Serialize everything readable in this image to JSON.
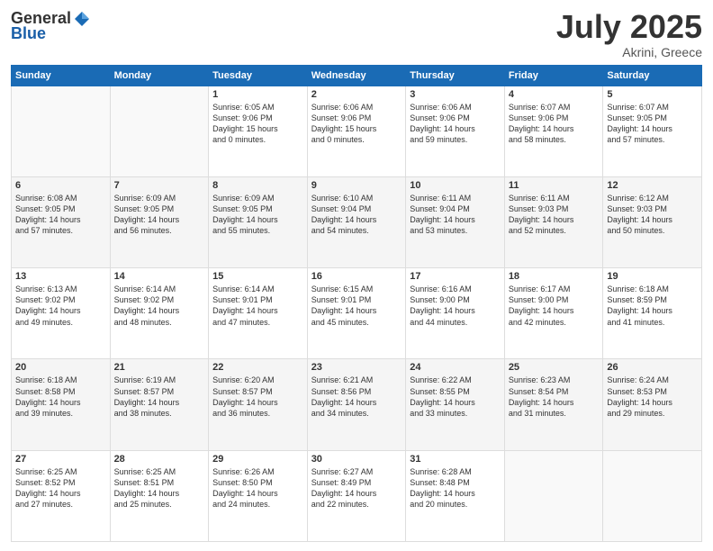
{
  "header": {
    "logo_general": "General",
    "logo_blue": "Blue",
    "month_year": "July 2025",
    "location": "Akrini, Greece"
  },
  "calendar": {
    "days_of_week": [
      "Sunday",
      "Monday",
      "Tuesday",
      "Wednesday",
      "Thursday",
      "Friday",
      "Saturday"
    ],
    "weeks": [
      [
        {
          "day": "",
          "content": ""
        },
        {
          "day": "",
          "content": ""
        },
        {
          "day": "1",
          "content": "Sunrise: 6:05 AM\nSunset: 9:06 PM\nDaylight: 15 hours\nand 0 minutes."
        },
        {
          "day": "2",
          "content": "Sunrise: 6:06 AM\nSunset: 9:06 PM\nDaylight: 15 hours\nand 0 minutes."
        },
        {
          "day": "3",
          "content": "Sunrise: 6:06 AM\nSunset: 9:06 PM\nDaylight: 14 hours\nand 59 minutes."
        },
        {
          "day": "4",
          "content": "Sunrise: 6:07 AM\nSunset: 9:06 PM\nDaylight: 14 hours\nand 58 minutes."
        },
        {
          "day": "5",
          "content": "Sunrise: 6:07 AM\nSunset: 9:05 PM\nDaylight: 14 hours\nand 57 minutes."
        }
      ],
      [
        {
          "day": "6",
          "content": "Sunrise: 6:08 AM\nSunset: 9:05 PM\nDaylight: 14 hours\nand 57 minutes."
        },
        {
          "day": "7",
          "content": "Sunrise: 6:09 AM\nSunset: 9:05 PM\nDaylight: 14 hours\nand 56 minutes."
        },
        {
          "day": "8",
          "content": "Sunrise: 6:09 AM\nSunset: 9:05 PM\nDaylight: 14 hours\nand 55 minutes."
        },
        {
          "day": "9",
          "content": "Sunrise: 6:10 AM\nSunset: 9:04 PM\nDaylight: 14 hours\nand 54 minutes."
        },
        {
          "day": "10",
          "content": "Sunrise: 6:11 AM\nSunset: 9:04 PM\nDaylight: 14 hours\nand 53 minutes."
        },
        {
          "day": "11",
          "content": "Sunrise: 6:11 AM\nSunset: 9:03 PM\nDaylight: 14 hours\nand 52 minutes."
        },
        {
          "day": "12",
          "content": "Sunrise: 6:12 AM\nSunset: 9:03 PM\nDaylight: 14 hours\nand 50 minutes."
        }
      ],
      [
        {
          "day": "13",
          "content": "Sunrise: 6:13 AM\nSunset: 9:02 PM\nDaylight: 14 hours\nand 49 minutes."
        },
        {
          "day": "14",
          "content": "Sunrise: 6:14 AM\nSunset: 9:02 PM\nDaylight: 14 hours\nand 48 minutes."
        },
        {
          "day": "15",
          "content": "Sunrise: 6:14 AM\nSunset: 9:01 PM\nDaylight: 14 hours\nand 47 minutes."
        },
        {
          "day": "16",
          "content": "Sunrise: 6:15 AM\nSunset: 9:01 PM\nDaylight: 14 hours\nand 45 minutes."
        },
        {
          "day": "17",
          "content": "Sunrise: 6:16 AM\nSunset: 9:00 PM\nDaylight: 14 hours\nand 44 minutes."
        },
        {
          "day": "18",
          "content": "Sunrise: 6:17 AM\nSunset: 9:00 PM\nDaylight: 14 hours\nand 42 minutes."
        },
        {
          "day": "19",
          "content": "Sunrise: 6:18 AM\nSunset: 8:59 PM\nDaylight: 14 hours\nand 41 minutes."
        }
      ],
      [
        {
          "day": "20",
          "content": "Sunrise: 6:18 AM\nSunset: 8:58 PM\nDaylight: 14 hours\nand 39 minutes."
        },
        {
          "day": "21",
          "content": "Sunrise: 6:19 AM\nSunset: 8:57 PM\nDaylight: 14 hours\nand 38 minutes."
        },
        {
          "day": "22",
          "content": "Sunrise: 6:20 AM\nSunset: 8:57 PM\nDaylight: 14 hours\nand 36 minutes."
        },
        {
          "day": "23",
          "content": "Sunrise: 6:21 AM\nSunset: 8:56 PM\nDaylight: 14 hours\nand 34 minutes."
        },
        {
          "day": "24",
          "content": "Sunrise: 6:22 AM\nSunset: 8:55 PM\nDaylight: 14 hours\nand 33 minutes."
        },
        {
          "day": "25",
          "content": "Sunrise: 6:23 AM\nSunset: 8:54 PM\nDaylight: 14 hours\nand 31 minutes."
        },
        {
          "day": "26",
          "content": "Sunrise: 6:24 AM\nSunset: 8:53 PM\nDaylight: 14 hours\nand 29 minutes."
        }
      ],
      [
        {
          "day": "27",
          "content": "Sunrise: 6:25 AM\nSunset: 8:52 PM\nDaylight: 14 hours\nand 27 minutes."
        },
        {
          "day": "28",
          "content": "Sunrise: 6:25 AM\nSunset: 8:51 PM\nDaylight: 14 hours\nand 25 minutes."
        },
        {
          "day": "29",
          "content": "Sunrise: 6:26 AM\nSunset: 8:50 PM\nDaylight: 14 hours\nand 24 minutes."
        },
        {
          "day": "30",
          "content": "Sunrise: 6:27 AM\nSunset: 8:49 PM\nDaylight: 14 hours\nand 22 minutes."
        },
        {
          "day": "31",
          "content": "Sunrise: 6:28 AM\nSunset: 8:48 PM\nDaylight: 14 hours\nand 20 minutes."
        },
        {
          "day": "",
          "content": ""
        },
        {
          "day": "",
          "content": ""
        }
      ]
    ]
  }
}
